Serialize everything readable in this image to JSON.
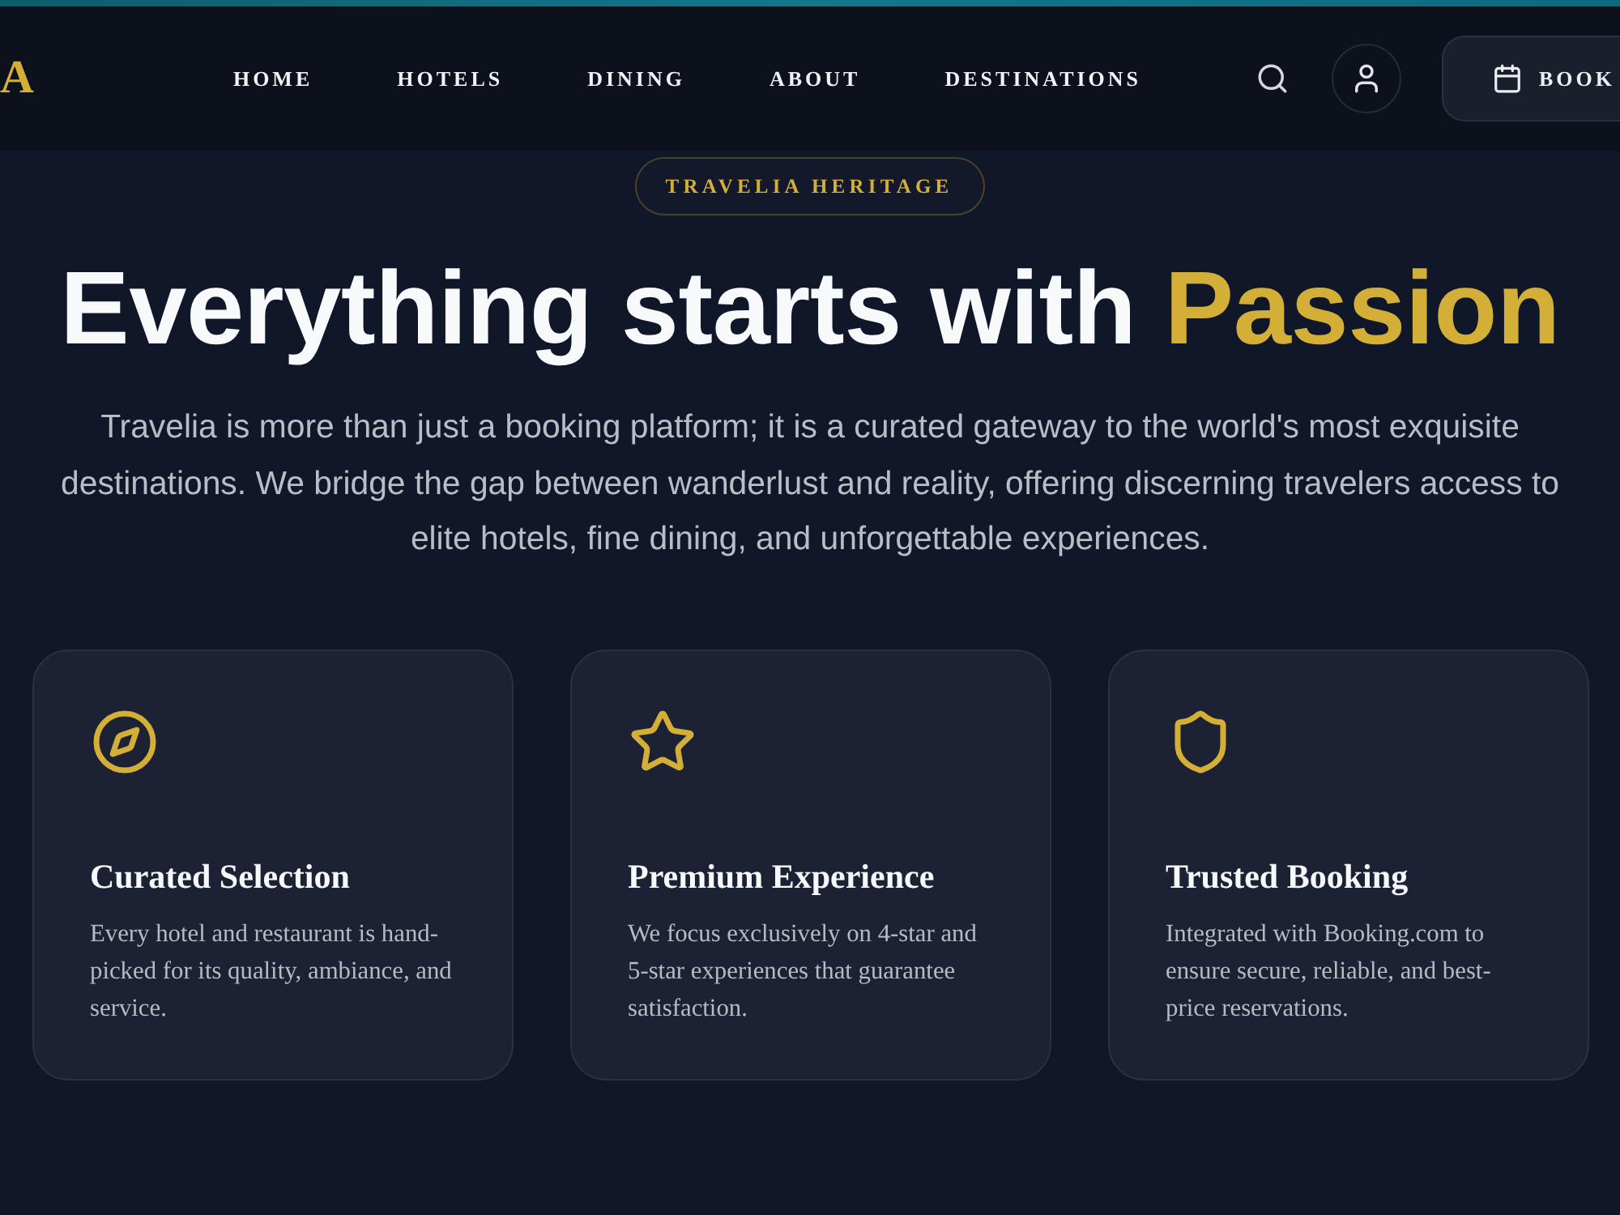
{
  "header": {
    "logo": "A",
    "nav": [
      {
        "label": "HOME"
      },
      {
        "label": "HOTELS"
      },
      {
        "label": "DINING"
      },
      {
        "label": "ABOUT"
      },
      {
        "label": "DESTINATIONS"
      }
    ],
    "book_button": "BOOK"
  },
  "hero": {
    "badge": "TRAVELIA HERITAGE",
    "title": "Everything starts with",
    "title_highlight": "Passion",
    "intro": "Travelia is more than just a booking platform; it is a curated gateway to the world's most exquisite destinations. We bridge the gap between wanderlust and reality, offering discerning travelers access to elite hotels, fine dining, and unforgettable experiences."
  },
  "features": [
    {
      "kind": "compass",
      "title": "Curated Selection",
      "text": "Every hotel and restaurant is hand-picked for its quality, ambiance, and service."
    },
    {
      "kind": "star",
      "title": "Premium Experience",
      "text": "We focus exclusively on 4-star and 5-star experiences that guarantee satisfaction."
    },
    {
      "kind": "shield",
      "title": "Trusted Booking",
      "text": "Integrated with Booking.com to ensure secure, reliable, and best-price reservations."
    }
  ]
}
